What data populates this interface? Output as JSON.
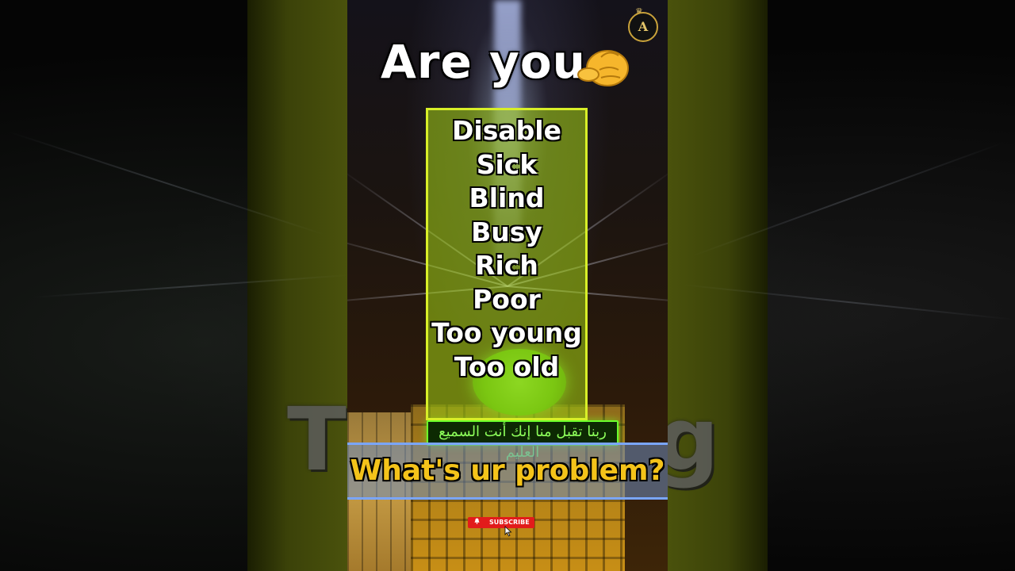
{
  "video": {
    "title": "Are you",
    "title_emoji": "pointing-hand-icon",
    "logo_letter": "A",
    "list_items": [
      "Disable",
      "Sick",
      "Blind",
      "Busy",
      "Rich",
      "Poor",
      "Too young",
      "Too old"
    ],
    "banner_text": "What's ur problem?",
    "subscribe_label": "SUBSCRIBE",
    "arabic_band_text": "ربنا تقبل منا إنك أنت السميع العليم"
  },
  "background": {
    "ghost_left": "T",
    "ghost_right": "g"
  },
  "colors": {
    "list_box_border": "#d8ef28",
    "banner_text": "#f4c31a",
    "banner_border": "#7aa6ff",
    "subscribe_bg": "#e21b1b"
  }
}
